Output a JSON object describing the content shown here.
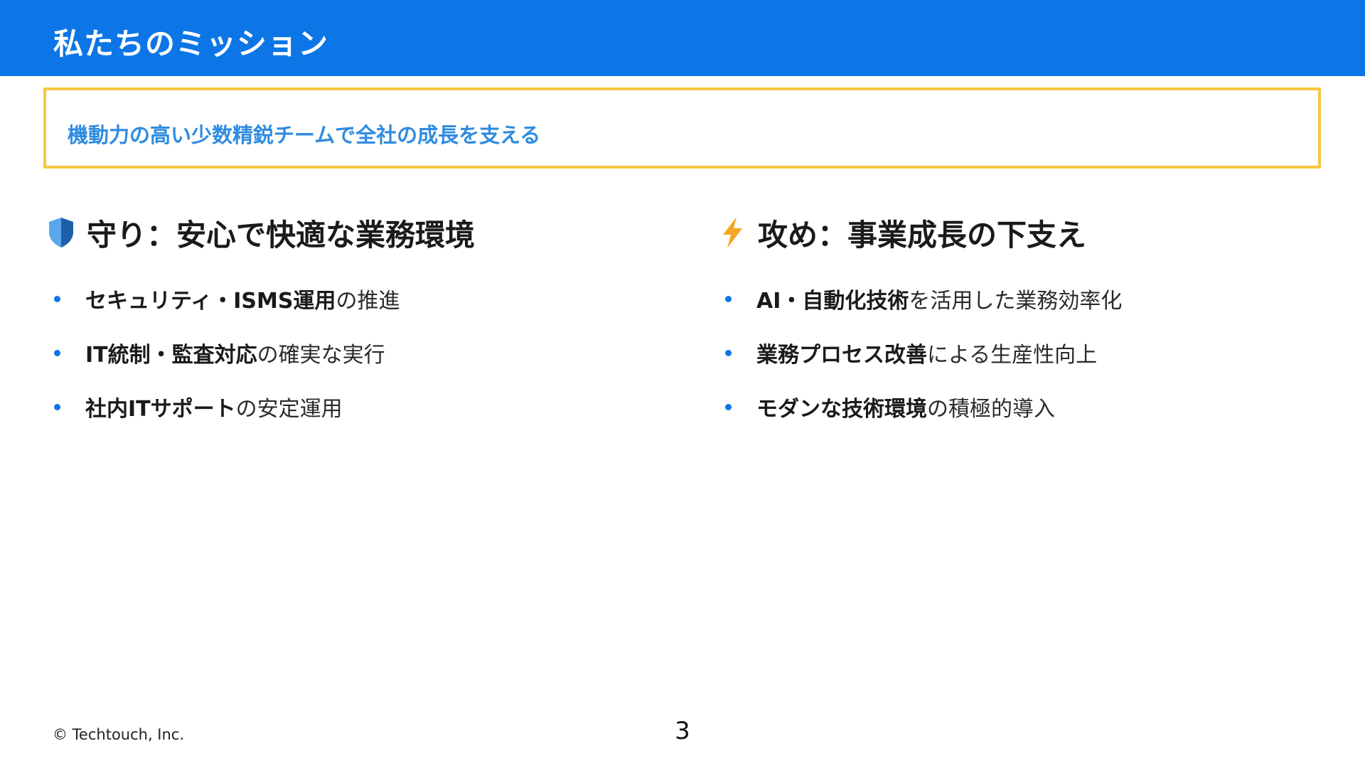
{
  "header": {
    "title": "私たちのミッション",
    "bar_color": "#0c76e6"
  },
  "mission": {
    "text": "機動力の高い少数精鋭チームで全社の成長を支える",
    "border_color": "#f5c842",
    "text_color": "#2f8be0"
  },
  "columns": [
    {
      "icon": "shield-icon",
      "heading": "守り：安心で快適な業務環境",
      "items": [
        {
          "strong": "セキュリティ・ISMS運用",
          "rest": "の推進"
        },
        {
          "strong": "IT統制・監査対応",
          "rest": "の確実な実行"
        },
        {
          "strong": "社内ITサポート",
          "rest": "の安定運用"
        }
      ]
    },
    {
      "icon": "lightning-icon",
      "heading": "攻め：事業成長の下支え",
      "items": [
        {
          "strong": "AI・自動化技術",
          "rest": "を活用した業務効率化"
        },
        {
          "strong": "業務プロセス改善",
          "rest": "による生産性向上"
        },
        {
          "strong": "モダンな技術環境",
          "rest": "の積極的導入"
        }
      ]
    }
  ],
  "footer": {
    "copyright": "© Techtouch, Inc.",
    "page_number": "3"
  }
}
